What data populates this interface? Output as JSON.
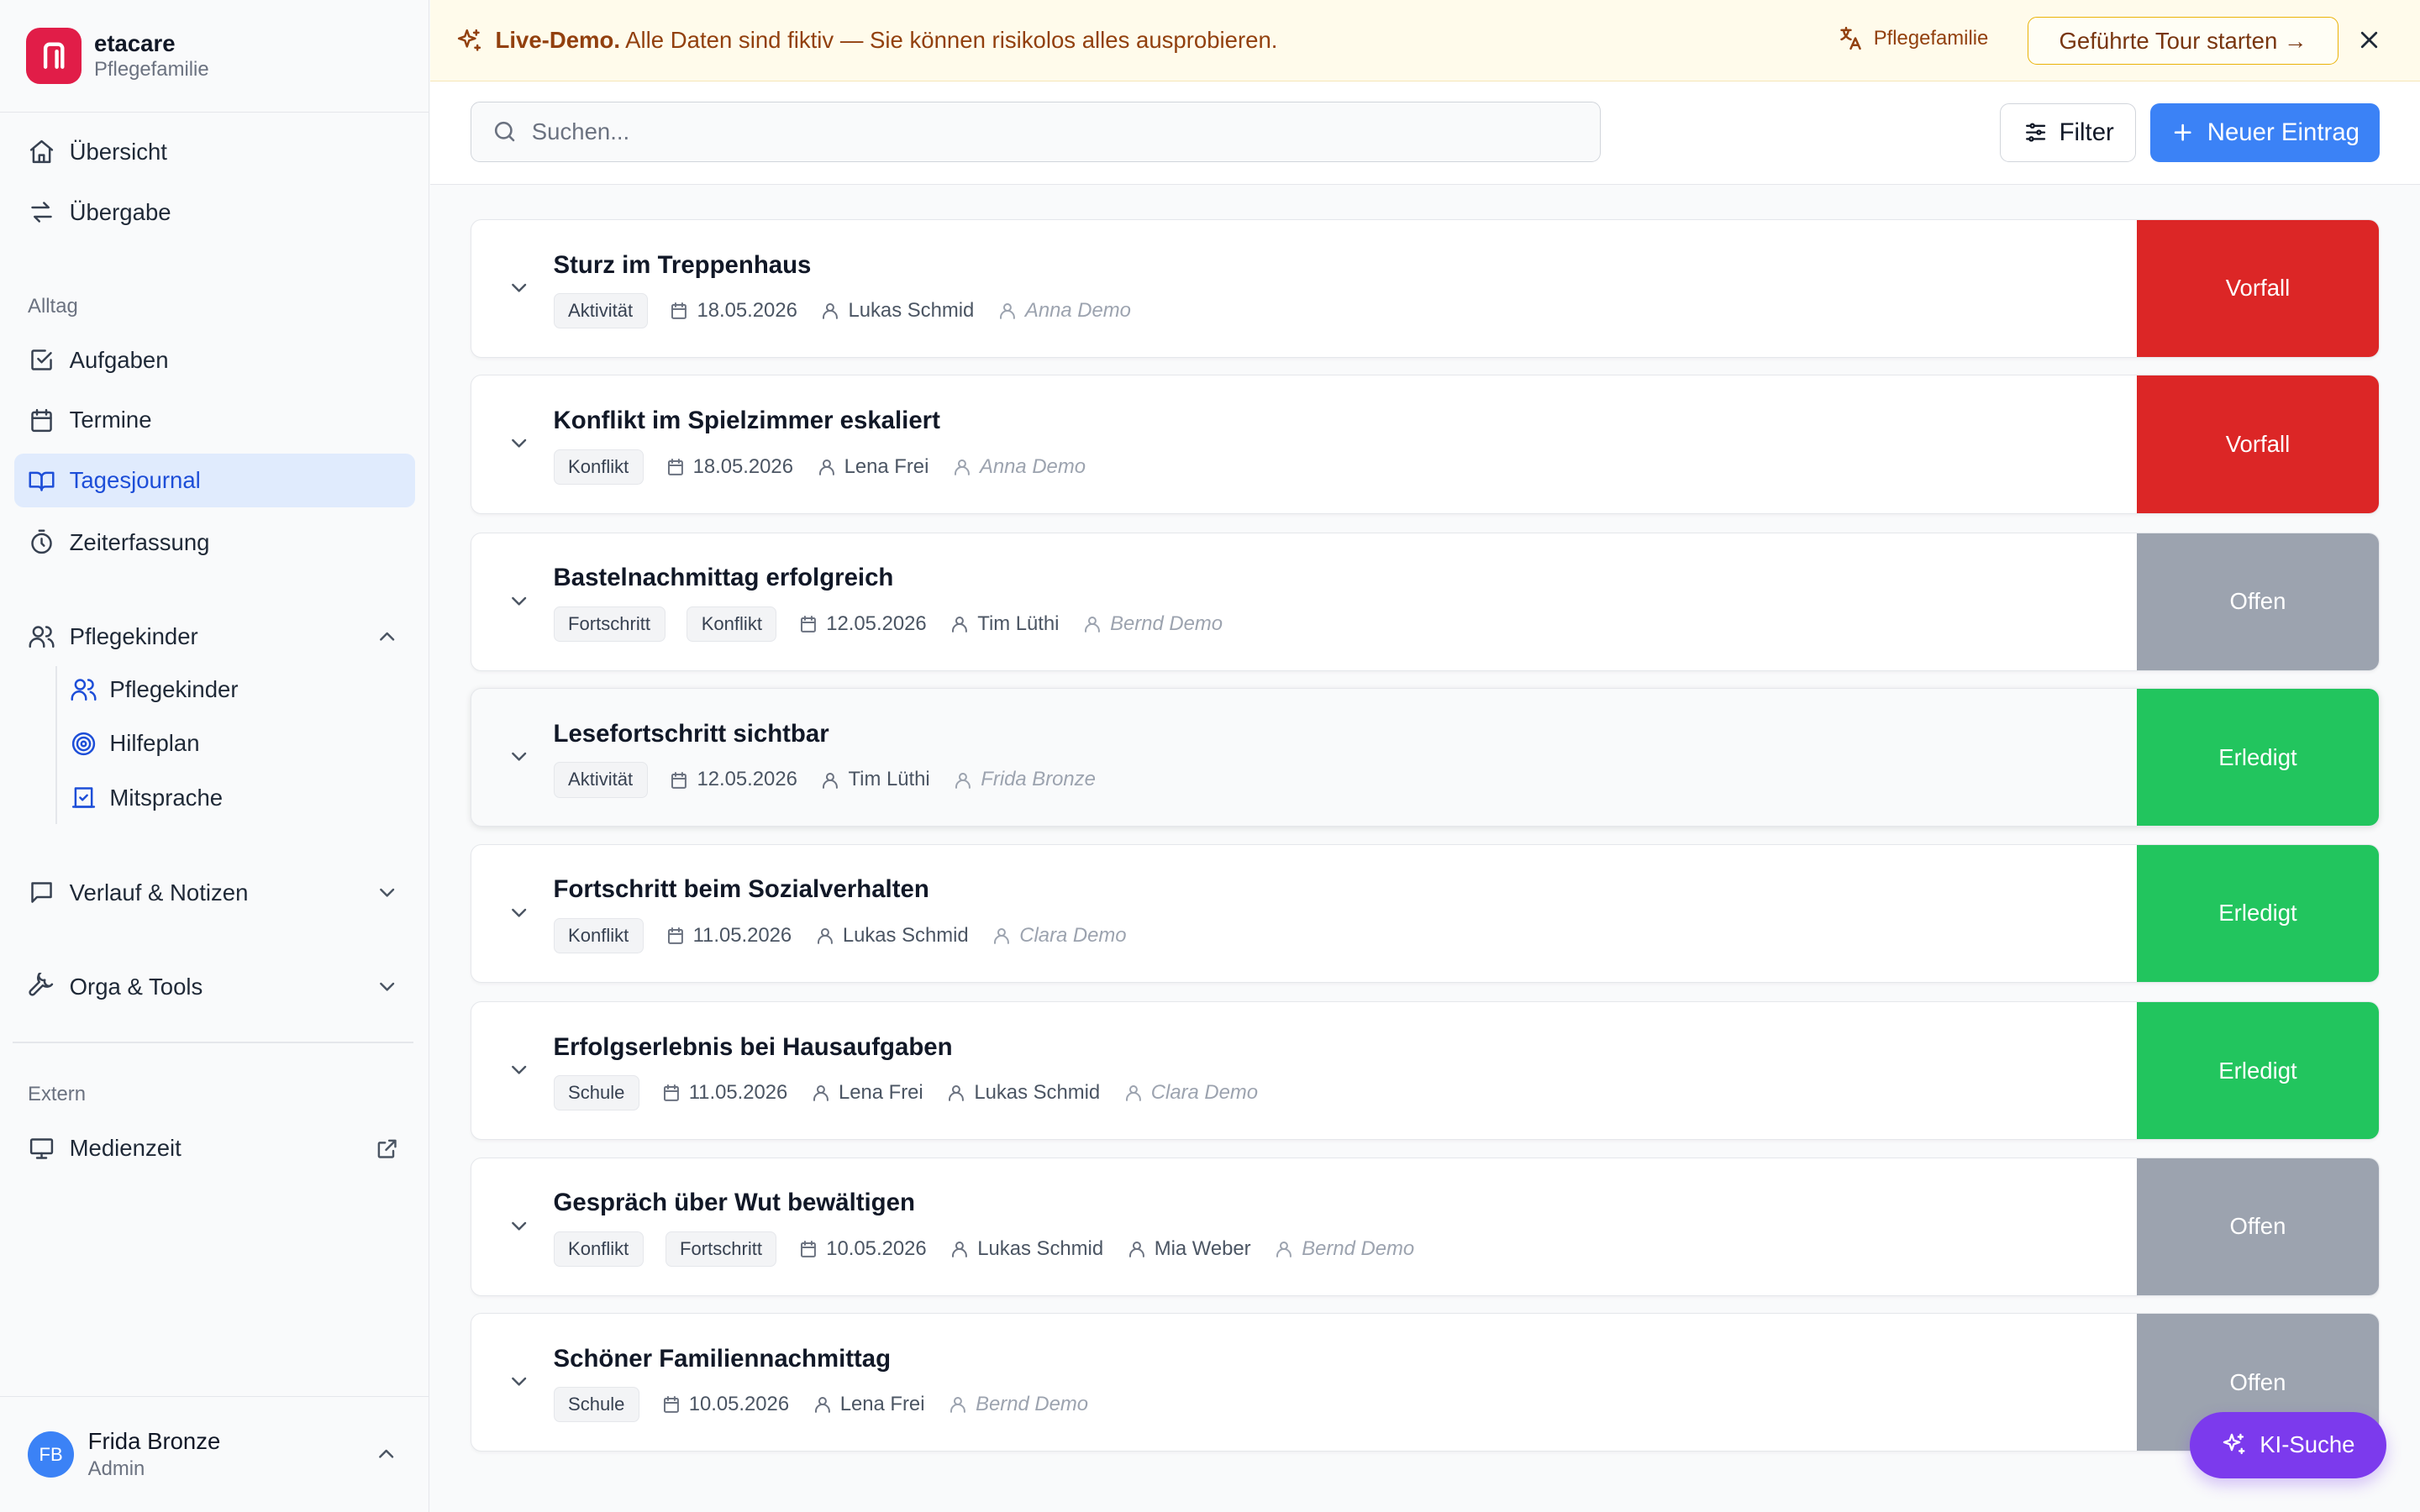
{
  "brand": {
    "name": "etacare",
    "subtitle": "Pflegefamilie"
  },
  "nav": {
    "overview": "Übersicht",
    "handover": "Übergabe",
    "section_alltag": "Alltag",
    "tasks": "Aufgaben",
    "appointments": "Termine",
    "journal": "Tagesjournal",
    "time_tracking": "Zeiterfassung",
    "foster_group": "Pflegekinder",
    "foster_children": "Pflegekinder",
    "help_plan": "Hilfeplan",
    "participation": "Mitsprache",
    "history_notes": "Verlauf & Notizen",
    "org_tools": "Orga & Tools",
    "section_extern": "Extern",
    "media_time": "Medienzeit"
  },
  "user": {
    "initials": "FB",
    "name": "Frida Bronze",
    "role": "Admin"
  },
  "banner": {
    "label": "Live-Demo.",
    "text": "Alle Daten sind fiktiv — Sie können risikolos alles ausprobieren.",
    "language": "Pflegefamilie",
    "tour_button": "Geführte Tour starten →"
  },
  "toolbar": {
    "search_placeholder": "Suchen...",
    "filter_label": "Filter",
    "new_entry_label": "Neuer Eintrag"
  },
  "entries": [
    {
      "title": "Sturz im Treppenhaus",
      "tags": [
        "Aktivität"
      ],
      "date": "18.05.2026",
      "persons": [
        "Lukas Schmid"
      ],
      "author": "Anna Demo",
      "status": "Vorfall"
    },
    {
      "title": "Konflikt im Spielzimmer eskaliert",
      "tags": [
        "Konflikt"
      ],
      "date": "18.05.2026",
      "persons": [
        "Lena Frei"
      ],
      "author": "Anna Demo",
      "status": "Vorfall"
    },
    {
      "title": "Bastelnachmittag erfolgreich",
      "tags": [
        "Fortschritt",
        "Konflikt"
      ],
      "date": "12.05.2026",
      "persons": [
        "Tim Lüthi"
      ],
      "author": "Bernd Demo",
      "status": "Offen"
    },
    {
      "title": "Lesefortschritt sichtbar",
      "tags": [
        "Aktivität"
      ],
      "date": "12.05.2026",
      "persons": [
        "Tim Lüthi"
      ],
      "author": "Frida Bronze",
      "status": "Erledigt"
    },
    {
      "title": "Fortschritt beim Sozialverhalten",
      "tags": [
        "Konflikt"
      ],
      "date": "11.05.2026",
      "persons": [
        "Lukas Schmid"
      ],
      "author": "Clara Demo",
      "status": "Erledigt"
    },
    {
      "title": "Erfolgserlebnis bei Hausaufgaben",
      "tags": [
        "Schule"
      ],
      "date": "11.05.2026",
      "persons": [
        "Lena Frei",
        "Lukas Schmid"
      ],
      "author": "Clara Demo",
      "status": "Erledigt"
    },
    {
      "title": "Gespräch über Wut bewältigen",
      "tags": [
        "Konflikt",
        "Fortschritt"
      ],
      "date": "10.05.2026",
      "persons": [
        "Lukas Schmid",
        "Mia Weber"
      ],
      "author": "Bernd Demo",
      "status": "Offen"
    },
    {
      "title": "Schöner Familiennachmittag",
      "tags": [
        "Schule"
      ],
      "date": "10.05.2026",
      "persons": [
        "Lena Frei"
      ],
      "author": "Bernd Demo",
      "status": "Offen"
    }
  ],
  "status_colors": {
    "Vorfall": "#dc2626",
    "Offen": "#9ca3af",
    "Erledigt": "#22c55e"
  },
  "ki_search_label": "KI-Suche"
}
